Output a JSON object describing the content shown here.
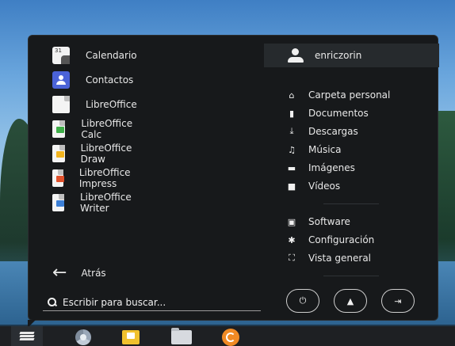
{
  "apps": [
    {
      "label": "Calendario",
      "icon": "calendar-icon",
      "badge": "31"
    },
    {
      "label": "Contactos",
      "icon": "contacts-icon"
    },
    {
      "label": "LibreOffice",
      "icon": "libreoffice-icon"
    },
    {
      "label": "LibreOffice Calc",
      "icon": "libreoffice-calc-icon"
    },
    {
      "label": "LibreOffice Draw",
      "icon": "libreoffice-draw-icon"
    },
    {
      "label": "LibreOffice Impress",
      "icon": "libreoffice-impress-icon"
    },
    {
      "label": "LibreOffice Writer",
      "icon": "libreoffice-writer-icon"
    }
  ],
  "back_label": "Atrás",
  "search": {
    "placeholder": "Escribir para buscar..."
  },
  "user": {
    "name": "enriczorin"
  },
  "places": [
    {
      "label": "Carpeta personal",
      "icon": "home-icon"
    },
    {
      "label": "Documentos",
      "icon": "document-icon"
    },
    {
      "label": "Descargas",
      "icon": "download-icon"
    },
    {
      "label": "Música",
      "icon": "music-icon"
    },
    {
      "label": "Imágenes",
      "icon": "image-icon"
    },
    {
      "label": "Vídeos",
      "icon": "video-icon"
    }
  ],
  "system": [
    {
      "label": "Software",
      "icon": "software-icon"
    },
    {
      "label": "Configuración",
      "icon": "settings-icon"
    },
    {
      "label": "Vista general",
      "icon": "overview-icon"
    }
  ],
  "session_buttons": [
    "power-icon",
    "lock-icon",
    "logout-icon"
  ],
  "taskbar": [
    "zorin-menu-icon",
    "chrome-icon",
    "mail-icon",
    "files-icon",
    "update-icon"
  ],
  "colors": {
    "menu_bg": "#17191b",
    "user_bar_bg": "#262a2d",
    "taskbar_bg": "#1e2023"
  }
}
